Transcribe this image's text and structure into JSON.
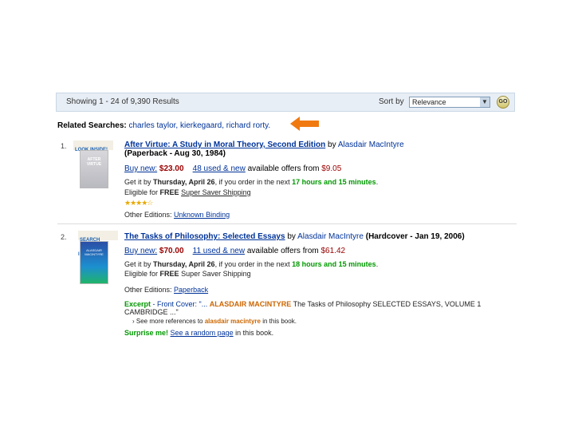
{
  "toolbar": {
    "showing": "Showing 1 - 24 of 9,390 Results",
    "sort_label": "Sort by",
    "sort_value": "Relevance",
    "go_label": "GO"
  },
  "related": {
    "label": "Related Searches:",
    "items": [
      "charles taylor,",
      "kierkegaard,",
      "richard rorty."
    ]
  },
  "results": [
    {
      "number": "1.",
      "badge": "LOOK INSIDE!",
      "cover_title": "AFTER VIRTUE",
      "title": "After Virtue: A Study in Moral Theory, Second Edition",
      "by": "by",
      "author": "Alasdair MacIntyre",
      "format": "(Paperback - Aug 30, 1984)",
      "buy_label": "Buy new:",
      "price": "$23.00",
      "offers_link": "48 used & new",
      "offers_text": "available offers",
      "offers_from": "from",
      "offers_price": "$9.05",
      "get_it": "Get it by",
      "get_day": "Thursday, April 26",
      "get_mid": "if you order in the next",
      "get_time": "17 hours and 15 minutes",
      "eligible_pre": "Eligible for",
      "eligible_bold": "FREE",
      "eligible_post": "Super Saver Shipping",
      "stars": "★★★★☆",
      "other_label": "Other Editions:",
      "other_value": "Unknown Binding"
    },
    {
      "number": "2.",
      "badge": "SEARCH INSIDE!",
      "cover_title": "ALASDAIR MACINTYRE",
      "title": "The Tasks of Philosophy: Selected Essays",
      "by": "by",
      "author": "Alasdair MacIntyre",
      "format": "(Hardcover - Jan 19, 2006)",
      "buy_label": "Buy new:",
      "price": "$70.00",
      "offers_link": "11 used & new",
      "offers_text": "available offers",
      "offers_from": "from",
      "offers_price": "$61.42",
      "get_it": "Get it by",
      "get_day": "Thursday, April 26",
      "get_mid": "if you order in the next",
      "get_time": "18 hours and 15 minutes",
      "eligible_pre": "Eligible for",
      "eligible_bold": "FREE",
      "eligible_post": "Super Saver Shipping",
      "other_label": "Other Editions:",
      "other_value": "Paperback",
      "excerpt_label": "Excerpt",
      "excerpt_source": "- Front Cover: \"...",
      "excerpt_highlight": "ALASDAIR MACINTYRE",
      "excerpt_text": "The Tasks of Philosophy SELECTED ESSAYS, VOLUME 1",
      "excerpt_text2": "CAMBRIDGE ...\"",
      "see_more_pre": "› See more references to",
      "see_more_link": "alasdair macintyre",
      "see_more_post": "in this book.",
      "surprise_label": "Surprise me!",
      "surprise_link": "See a random page",
      "surprise_post": "in this book."
    }
  ],
  "colors": {
    "link": "#003399",
    "price": "#990000",
    "green": "#009900",
    "arrow": "#f07a10"
  }
}
